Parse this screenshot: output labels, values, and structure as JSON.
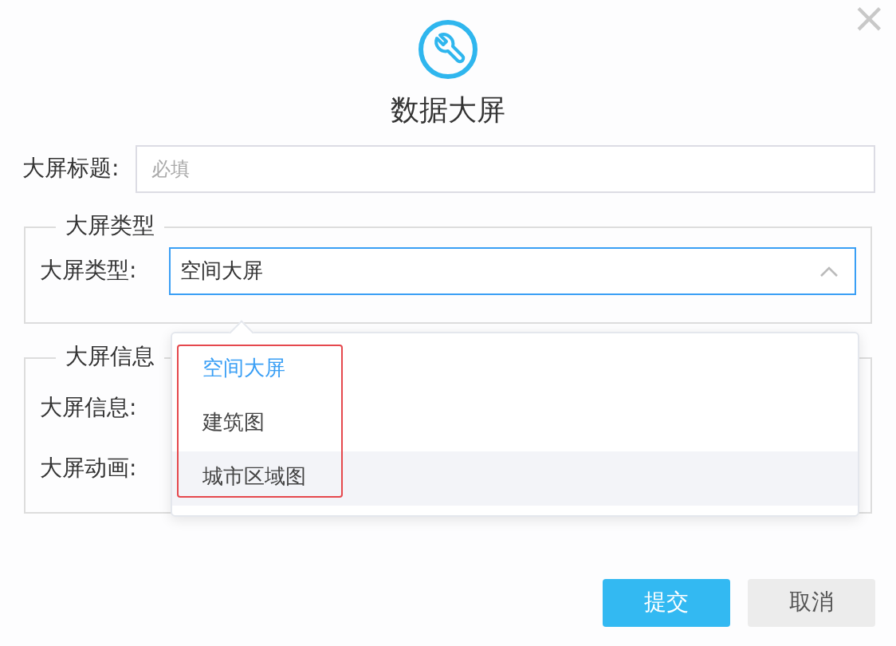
{
  "dialog": {
    "title": "数据大屏",
    "close": "×"
  },
  "title_field": {
    "label": "大屏标题:",
    "placeholder": "必填"
  },
  "sections": [
    {
      "legend": "大屏类型",
      "rows": [
        {
          "label": "大屏类型:",
          "value": "空间大屏",
          "open": true
        }
      ]
    },
    {
      "legend": "大屏信息",
      "rows": [
        {
          "label": "大屏信息:"
        },
        {
          "label": "大屏动画:"
        }
      ]
    }
  ],
  "dropdown": {
    "annotated": true,
    "options": [
      {
        "label": "空间大屏",
        "selected": true,
        "hovered": false
      },
      {
        "label": "建筑图",
        "selected": false,
        "hovered": false
      },
      {
        "label": "城市区域图",
        "selected": false,
        "hovered": true
      }
    ]
  },
  "buttons": [
    {
      "label": "提交",
      "kind": "primary"
    },
    {
      "label": "取消",
      "kind": "secondary"
    }
  ]
}
